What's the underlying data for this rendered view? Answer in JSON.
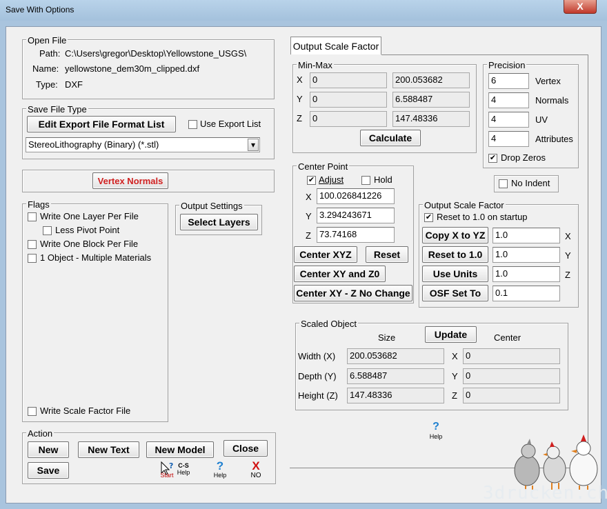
{
  "window": {
    "title": "Save With Options",
    "close_glyph": "X"
  },
  "open_file": {
    "label": "Open File",
    "path_label": "Path:",
    "path_value": "C:\\Users\\gregor\\Desktop\\Yellowstone_USGS\\",
    "name_label": "Name:",
    "name_value": "yellowstone_dem30m_clipped.dxf",
    "type_label": "Type:",
    "type_value": "DXF"
  },
  "save_file_type": {
    "label": "Save File Type",
    "edit_button": "Edit Export File Format List",
    "use_export_list": "Use Export List",
    "use_export_list_checked": false,
    "selected": "StereoLithography (Binary) (*.stl)",
    "arrow": "▾"
  },
  "vertex_normals": "Vertex Normals",
  "flags": {
    "label": "Flags",
    "write_one_layer": "Write One Layer Per File",
    "less_pivot": "Less Pivot Point",
    "write_one_block": "Write One Block Per File",
    "one_object": "1 Object - Multiple Materials",
    "write_scale_factor": "Write Scale Factor File"
  },
  "output_settings": {
    "label": "Output Settings",
    "select_layers": "Select Layers"
  },
  "action": {
    "label": "Action",
    "new": "New",
    "new_text": "New Text",
    "new_model": "New Model",
    "close": "Close",
    "save": "Save",
    "start_caption": "Start",
    "cs_help_line1": "C-S",
    "cs_help_line2": "Help",
    "help_caption": "Help",
    "no_caption": "NO"
  },
  "tab": {
    "label": "Output Scale Factor"
  },
  "min_max": {
    "label": "Min-Max",
    "x_label": "X",
    "y_label": "Y",
    "z_label": "Z",
    "x_min": "0",
    "x_max": "200.053682",
    "y_min": "0",
    "y_max": "6.588487",
    "z_min": "0",
    "z_max": "147.48336",
    "calculate": "Calculate"
  },
  "precision": {
    "label": "Precision",
    "vertex": "6",
    "vertex_label": "Vertex",
    "normals": "4",
    "normals_label": "Normals",
    "uv": "4",
    "uv_label": "UV",
    "attributes": "4",
    "attributes_label": "Attributes",
    "drop_zeros": "Drop Zeros",
    "drop_zeros_checked": true
  },
  "no_indent": "No Indent",
  "center_point": {
    "label": "Center Point",
    "adjust": "Adjust",
    "adjust_checked": true,
    "hold": "Hold",
    "hold_checked": false,
    "x_label": "X",
    "x": "100.026841226",
    "y_label": "Y",
    "y": "3.294243671",
    "z_label": "Z",
    "z": "73.74168",
    "center_xyz": "Center XYZ",
    "reset": "Reset",
    "center_xy_z0": "Center XY and Z0",
    "center_xy_nochange": "Center XY - Z No Change"
  },
  "osf": {
    "label": "Output Scale Factor",
    "reset_on_startup": "Reset to 1.0 on startup",
    "reset_checked": true,
    "copy_x_to_yz": "Copy X to YZ",
    "reset_to_one": "Reset to 1.0",
    "use_units": "Use Units",
    "osf_set_to": "OSF Set To",
    "x": "1.0",
    "y": "1.0",
    "z": "1.0",
    "set_to": "0.1",
    "x_label": "X",
    "y_label": "Y",
    "z_label": "Z"
  },
  "scaled_object": {
    "label": "Scaled Object",
    "size_header": "Size",
    "update": "Update",
    "center_header": "Center",
    "width_label": "Width (X)",
    "width": "200.053682",
    "depth_label": "Depth (Y)",
    "depth": "6.588487",
    "height_label": "Height (Z)",
    "height": "147.48336",
    "cx_label": "X",
    "cx": "0",
    "cy_label": "Y",
    "cy": "0",
    "cz_label": "Z",
    "cz": "0"
  },
  "help_icon_caption": "Help",
  "watermark": "3drucken.ch",
  "check_glyph": "✔"
}
